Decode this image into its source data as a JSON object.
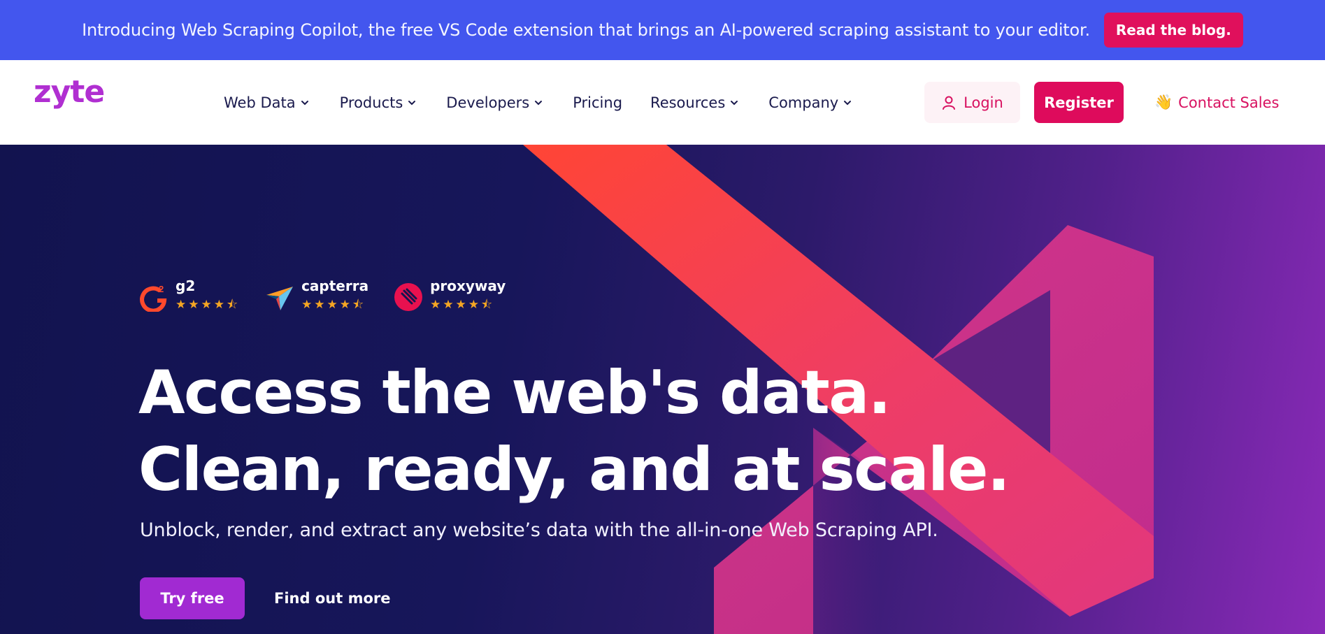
{
  "announcement": {
    "text": "Introducing Web Scraping Copilot, the free VS Code extension that brings an AI-powered scraping assistant to your editor.",
    "button_label": "Read the blog."
  },
  "header": {
    "logo_text": "zyte",
    "nav": [
      {
        "label": "Web Data",
        "has_dropdown": true
      },
      {
        "label": "Products",
        "has_dropdown": true
      },
      {
        "label": "Developers",
        "has_dropdown": true
      },
      {
        "label": "Pricing",
        "has_dropdown": false
      },
      {
        "label": "Resources",
        "has_dropdown": true
      },
      {
        "label": "Company",
        "has_dropdown": true
      }
    ],
    "login_label": "Login",
    "register_label": "Register",
    "contact_label": "Contact Sales",
    "contact_emoji": "👋"
  },
  "hero": {
    "ratings": [
      {
        "name": "g2",
        "stars": "★★★★⯪",
        "rating": 4.5
      },
      {
        "name": "capterra",
        "stars": "★★★★⯪",
        "rating": 4.5
      },
      {
        "name": "proxyway",
        "stars": "★★★★⯪",
        "rating": 4.5
      }
    ],
    "headline_line1": "Access the web's data.",
    "headline_line2": "Clean, ready, and at scale.",
    "subline": "Unblock, render, and extract any website’s data with the all-in-one Web Scraping API.",
    "try_label": "Try free",
    "find_label": "Find out more"
  },
  "colors": {
    "announce_bg": "#4356ee",
    "accent_pink": "#de0b5c",
    "brand_purple": "#b02fd1",
    "hero_navy": "#14154f",
    "try_purple": "#a12ad2",
    "star_gold": "#f5a623"
  }
}
